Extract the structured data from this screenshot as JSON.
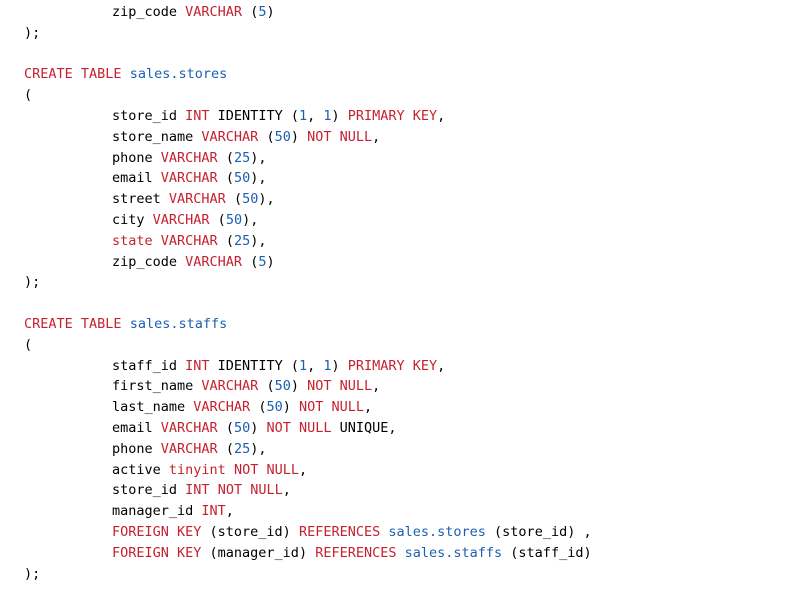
{
  "colors": {
    "keyword": "#c5222f",
    "number": "#1c5fb0",
    "identifier": "#1c5fb0",
    "plain": "#000000",
    "background": "#ffffff"
  },
  "code_lines": [
    {
      "indent": true,
      "tokens": [
        {
          "t": "zip_code ",
          "k": "plain"
        },
        {
          "t": "VARCHAR",
          "k": "kw"
        },
        {
          "t": " (",
          "k": "plain"
        },
        {
          "t": "5",
          "k": "num"
        },
        {
          "t": ")",
          "k": "plain"
        }
      ]
    },
    {
      "indent": false,
      "tokens": [
        {
          "t": ");",
          "k": "plain"
        }
      ]
    },
    {
      "indent": false,
      "tokens": []
    },
    {
      "indent": false,
      "tokens": [
        {
          "t": "CREATE",
          "k": "kw"
        },
        {
          "t": " ",
          "k": "plain"
        },
        {
          "t": "TABLE",
          "k": "kw"
        },
        {
          "t": " ",
          "k": "plain"
        },
        {
          "t": "sales.stores",
          "k": "tbl"
        }
      ]
    },
    {
      "indent": false,
      "tokens": [
        {
          "t": "(",
          "k": "plain"
        }
      ]
    },
    {
      "indent": true,
      "tokens": [
        {
          "t": "store_id ",
          "k": "plain"
        },
        {
          "t": "INT",
          "k": "kw"
        },
        {
          "t": " IDENTITY (",
          "k": "plain"
        },
        {
          "t": "1",
          "k": "num"
        },
        {
          "t": ", ",
          "k": "plain"
        },
        {
          "t": "1",
          "k": "num"
        },
        {
          "t": ") ",
          "k": "plain"
        },
        {
          "t": "PRIMARY KEY",
          "k": "kw"
        },
        {
          "t": ",",
          "k": "plain"
        }
      ]
    },
    {
      "indent": true,
      "tokens": [
        {
          "t": "store_name ",
          "k": "plain"
        },
        {
          "t": "VARCHAR",
          "k": "kw"
        },
        {
          "t": " (",
          "k": "plain"
        },
        {
          "t": "50",
          "k": "num"
        },
        {
          "t": ") ",
          "k": "plain"
        },
        {
          "t": "NOT NULL",
          "k": "kw"
        },
        {
          "t": ",",
          "k": "plain"
        }
      ]
    },
    {
      "indent": true,
      "tokens": [
        {
          "t": "phone ",
          "k": "plain"
        },
        {
          "t": "VARCHAR",
          "k": "kw"
        },
        {
          "t": " (",
          "k": "plain"
        },
        {
          "t": "25",
          "k": "num"
        },
        {
          "t": "),",
          "k": "plain"
        }
      ]
    },
    {
      "indent": true,
      "tokens": [
        {
          "t": "email ",
          "k": "plain"
        },
        {
          "t": "VARCHAR",
          "k": "kw"
        },
        {
          "t": " (",
          "k": "plain"
        },
        {
          "t": "50",
          "k": "num"
        },
        {
          "t": "),",
          "k": "plain"
        }
      ]
    },
    {
      "indent": true,
      "tokens": [
        {
          "t": "street ",
          "k": "plain"
        },
        {
          "t": "VARCHAR",
          "k": "kw"
        },
        {
          "t": " (",
          "k": "plain"
        },
        {
          "t": "50",
          "k": "num"
        },
        {
          "t": "),",
          "k": "plain"
        }
      ]
    },
    {
      "indent": true,
      "tokens": [
        {
          "t": "city ",
          "k": "plain"
        },
        {
          "t": "VARCHAR",
          "k": "kw"
        },
        {
          "t": " (",
          "k": "plain"
        },
        {
          "t": "50",
          "k": "num"
        },
        {
          "t": "),",
          "k": "plain"
        }
      ]
    },
    {
      "indent": true,
      "tokens": [
        {
          "t": "state",
          "k": "kw"
        },
        {
          "t": " ",
          "k": "plain"
        },
        {
          "t": "VARCHAR",
          "k": "kw"
        },
        {
          "t": " (",
          "k": "plain"
        },
        {
          "t": "25",
          "k": "num"
        },
        {
          "t": "),",
          "k": "plain"
        }
      ]
    },
    {
      "indent": true,
      "tokens": [
        {
          "t": "zip_code ",
          "k": "plain"
        },
        {
          "t": "VARCHAR",
          "k": "kw"
        },
        {
          "t": " (",
          "k": "plain"
        },
        {
          "t": "5",
          "k": "num"
        },
        {
          "t": ")",
          "k": "plain"
        }
      ]
    },
    {
      "indent": false,
      "tokens": [
        {
          "t": ");",
          "k": "plain"
        }
      ]
    },
    {
      "indent": false,
      "tokens": []
    },
    {
      "indent": false,
      "tokens": [
        {
          "t": "CREATE",
          "k": "kw"
        },
        {
          "t": " ",
          "k": "plain"
        },
        {
          "t": "TABLE",
          "k": "kw"
        },
        {
          "t": " ",
          "k": "plain"
        },
        {
          "t": "sales.staffs",
          "k": "tbl"
        }
      ]
    },
    {
      "indent": false,
      "tokens": [
        {
          "t": "(",
          "k": "plain"
        }
      ]
    },
    {
      "indent": true,
      "tokens": [
        {
          "t": "staff_id ",
          "k": "plain"
        },
        {
          "t": "INT",
          "k": "kw"
        },
        {
          "t": " IDENTITY (",
          "k": "plain"
        },
        {
          "t": "1",
          "k": "num"
        },
        {
          "t": ", ",
          "k": "plain"
        },
        {
          "t": "1",
          "k": "num"
        },
        {
          "t": ") ",
          "k": "plain"
        },
        {
          "t": "PRIMARY KEY",
          "k": "kw"
        },
        {
          "t": ",",
          "k": "plain"
        }
      ]
    },
    {
      "indent": true,
      "tokens": [
        {
          "t": "first_name ",
          "k": "plain"
        },
        {
          "t": "VARCHAR",
          "k": "kw"
        },
        {
          "t": " (",
          "k": "plain"
        },
        {
          "t": "50",
          "k": "num"
        },
        {
          "t": ") ",
          "k": "plain"
        },
        {
          "t": "NOT NULL",
          "k": "kw"
        },
        {
          "t": ",",
          "k": "plain"
        }
      ]
    },
    {
      "indent": true,
      "tokens": [
        {
          "t": "last_name ",
          "k": "plain"
        },
        {
          "t": "VARCHAR",
          "k": "kw"
        },
        {
          "t": " (",
          "k": "plain"
        },
        {
          "t": "50",
          "k": "num"
        },
        {
          "t": ") ",
          "k": "plain"
        },
        {
          "t": "NOT NULL",
          "k": "kw"
        },
        {
          "t": ",",
          "k": "plain"
        }
      ]
    },
    {
      "indent": true,
      "tokens": [
        {
          "t": "email ",
          "k": "plain"
        },
        {
          "t": "VARCHAR",
          "k": "kw"
        },
        {
          "t": " (",
          "k": "plain"
        },
        {
          "t": "50",
          "k": "num"
        },
        {
          "t": ") ",
          "k": "plain"
        },
        {
          "t": "NOT NULL",
          "k": "kw"
        },
        {
          "t": " UNIQUE,",
          "k": "plain"
        }
      ]
    },
    {
      "indent": true,
      "tokens": [
        {
          "t": "phone ",
          "k": "plain"
        },
        {
          "t": "VARCHAR",
          "k": "kw"
        },
        {
          "t": " (",
          "k": "plain"
        },
        {
          "t": "25",
          "k": "num"
        },
        {
          "t": "),",
          "k": "plain"
        }
      ]
    },
    {
      "indent": true,
      "tokens": [
        {
          "t": "active ",
          "k": "plain"
        },
        {
          "t": "tinyint",
          "k": "kw"
        },
        {
          "t": " ",
          "k": "plain"
        },
        {
          "t": "NOT NULL",
          "k": "kw"
        },
        {
          "t": ",",
          "k": "plain"
        }
      ]
    },
    {
      "indent": true,
      "tokens": [
        {
          "t": "store_id ",
          "k": "plain"
        },
        {
          "t": "INT",
          "k": "kw"
        },
        {
          "t": " ",
          "k": "plain"
        },
        {
          "t": "NOT NULL",
          "k": "kw"
        },
        {
          "t": ",",
          "k": "plain"
        }
      ]
    },
    {
      "indent": true,
      "tokens": [
        {
          "t": "manager_id ",
          "k": "plain"
        },
        {
          "t": "INT",
          "k": "kw"
        },
        {
          "t": ",",
          "k": "plain"
        }
      ]
    },
    {
      "indent": true,
      "tokens": [
        {
          "t": "FOREIGN KEY",
          "k": "kw"
        },
        {
          "t": " (store_id) ",
          "k": "plain"
        },
        {
          "t": "REFERENCES",
          "k": "kw"
        },
        {
          "t": " ",
          "k": "plain"
        },
        {
          "t": "sales.stores",
          "k": "tbl"
        },
        {
          "t": " (store_id) ,",
          "k": "plain"
        }
      ]
    },
    {
      "indent": true,
      "tokens": [
        {
          "t": "FOREIGN KEY",
          "k": "kw"
        },
        {
          "t": " (manager_id) ",
          "k": "plain"
        },
        {
          "t": "REFERENCES",
          "k": "kw"
        },
        {
          "t": " ",
          "k": "plain"
        },
        {
          "t": "sales.staffs",
          "k": "tbl"
        },
        {
          "t": " (staff_id)",
          "k": "plain"
        }
      ]
    },
    {
      "indent": false,
      "tokens": [
        {
          "t": ");",
          "k": "plain"
        }
      ]
    }
  ]
}
